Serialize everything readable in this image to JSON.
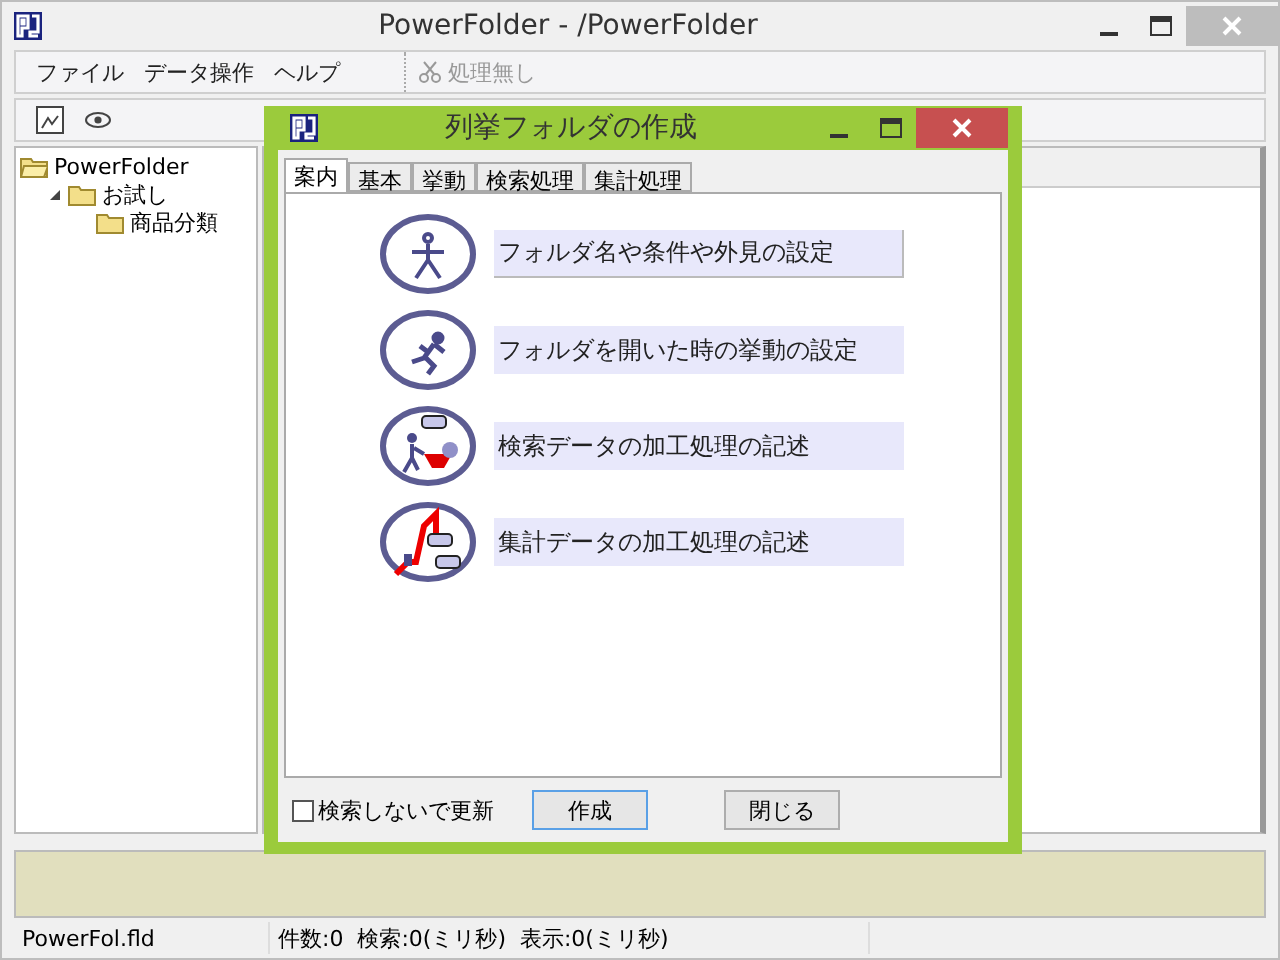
{
  "window": {
    "title": "PowerFolder - /PowerFolder"
  },
  "menu": [
    "ファイル",
    "データ操作",
    "ヘルプ"
  ],
  "toolbar": {
    "action": {
      "label": "処理無し",
      "disabled": true
    }
  },
  "tree": [
    {
      "label": "PowerFolder",
      "expanded": true,
      "children": [
        {
          "label": "お試し",
          "expanded": true,
          "children": [
            {
              "label": "商品分類"
            }
          ]
        }
      ]
    }
  ],
  "status_bar": [
    "PowerFol.fld",
    "件数:0  検索:0(ミリ秒)  表示:0(ミリ秒)"
  ],
  "dialog": {
    "title": "列挙フォルダの作成",
    "tabs": [
      {
        "label": "案内",
        "selected": true
      },
      {
        "label": "基本",
        "selected": false
      },
      {
        "label": "挙動",
        "selected": false
      },
      {
        "label": "検索処理",
        "selected": false
      },
      {
        "label": "集計処理",
        "selected": false
      }
    ],
    "items": [
      {
        "kind": "person",
        "label": "フォルダ名や条件や外見の設定",
        "hovered": true
      },
      {
        "kind": "runner",
        "label": "フォルダを開いた時の挙動の設定",
        "hovered": false
      },
      {
        "kind": "cart",
        "label": "検索データの加工処理の記述",
        "hovered": false
      },
      {
        "kind": "crane",
        "label": "集計データの加工処理の記述",
        "hovered": false
      }
    ],
    "checkbox": {
      "label": "検索しないで更新",
      "checked": false
    },
    "buttons": [
      {
        "label": "作成",
        "default": true
      },
      {
        "label": "閉じる",
        "default": false
      }
    ]
  }
}
